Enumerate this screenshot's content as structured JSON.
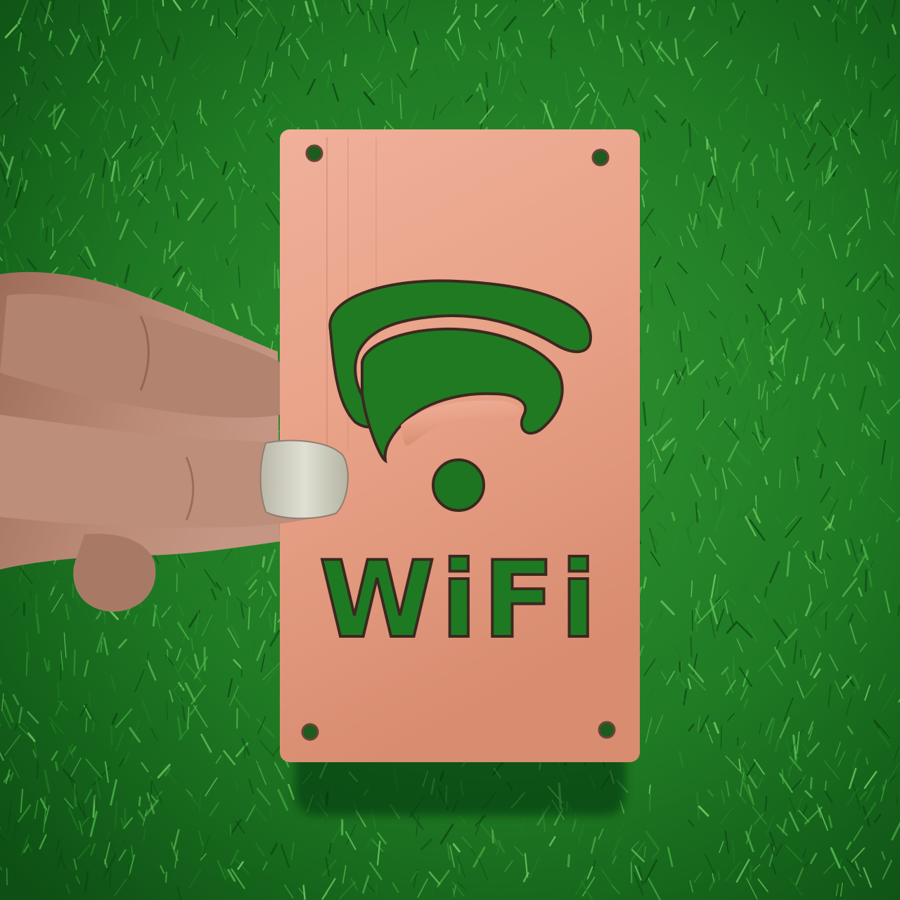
{
  "photo": {
    "sign_text": "WiFi",
    "colors": {
      "grass_dark": "#0c4a12",
      "grass_mid": "#1f7a24",
      "grass_light": "#4fb64a",
      "sign_copper": "#e8a288",
      "sign_copper_light": "#f2b9a3",
      "sign_copper_dark": "#c97f66",
      "cutout_shadow": "#3d2a22",
      "skin": "#b98a76",
      "skin_shadow": "#8a5f4e",
      "nail": "#cfd0c2"
    },
    "icons": [
      "wifi-signal-icon"
    ]
  }
}
